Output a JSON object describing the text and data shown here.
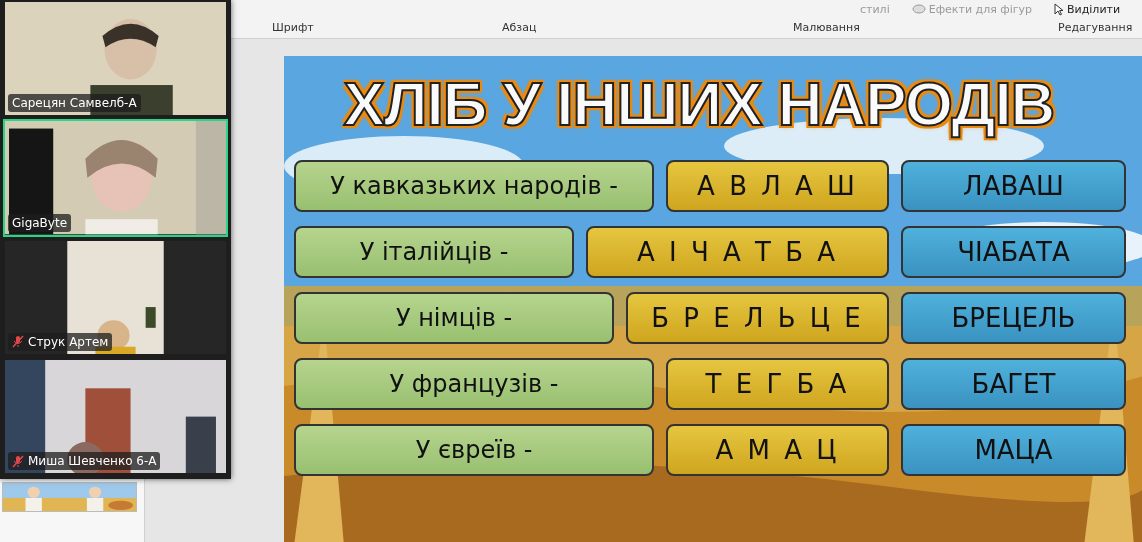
{
  "ribbon": {
    "groups": [
      {
        "label": "Шрифт"
      },
      {
        "label": "Абзац"
      },
      {
        "label": "Малювання"
      },
      {
        "label": "Редагування"
      }
    ],
    "commands": [
      {
        "kind": "styles",
        "label": "стилі"
      },
      {
        "kind": "effects",
        "label": "Ефекти для фігур"
      },
      {
        "kind": "select",
        "label": "Виділити"
      }
    ]
  },
  "video_call": {
    "participants": [
      {
        "name": "Сарецян Самвелб-А",
        "speaking": false,
        "muted": false
      },
      {
        "name": "GigaByte",
        "speaking": true,
        "muted": false
      },
      {
        "name": "Струк Артем",
        "speaking": false,
        "muted": true
      },
      {
        "name": "Миша Шевченко 6-А",
        "speaking": false,
        "muted": true
      }
    ]
  },
  "slide": {
    "title": "ХЛІБ У ІНШИХ НАРОДІВ",
    "rows": [
      {
        "prompt": "У кавказьких народів -",
        "scrambled": "А В Л А Ш",
        "answer": "ЛАВАШ"
      },
      {
        "prompt": "У італійців -",
        "scrambled": "А І Ч А Т Б А",
        "answer": "ЧІАБАТА"
      },
      {
        "prompt": "У німців -",
        "scrambled": "Б Р Е Л Ь Ц Е",
        "answer": "БРЕЦЕЛЬ"
      },
      {
        "prompt": "У французів -",
        "scrambled": "Т Е Г Б А",
        "answer": "БАГЕТ"
      },
      {
        "prompt": "У євреїв -",
        "scrambled": "А М А Ц",
        "answer": "МАЦА"
      }
    ]
  }
}
